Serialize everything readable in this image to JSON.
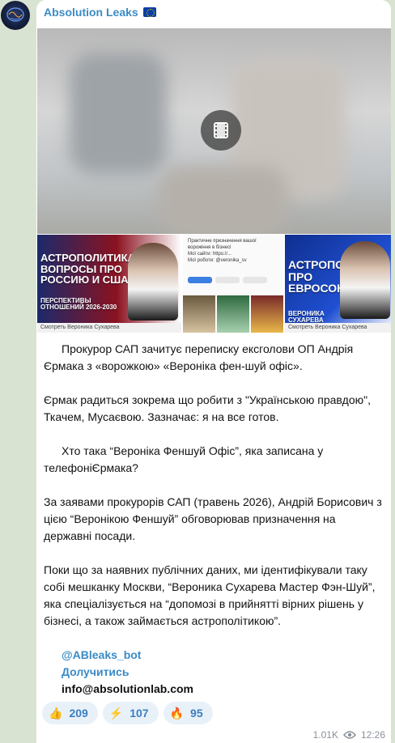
{
  "channel": {
    "name": "Absolution Leaks"
  },
  "thumbs": {
    "t1": {
      "title": "АСТРОПОЛИТИКА: ВОПРОСЫ ПРО РОССИЮ И США",
      "sub": "ПЕРСПЕКТИВЫ ОТНОШЕНИЙ 2026-2030",
      "caption": "Смотреть Вероника Сухарева"
    },
    "t2": {
      "lines": [
        "Практичне призначення вашої ворожіння в бізнесі",
        "Мої сайти: https://...",
        "Мої роботи: @veronika_sv"
      ],
      "caption": ""
    },
    "t3": {
      "title": "АСТРОПОЛИТИКА ПРО ЕВРОСОЮЗ",
      "sub": "ВЕРОНИКА СУХАРЕВА",
      "caption": "Смотреть Вероника Сухарева"
    }
  },
  "post": {
    "p1": "Прокурор САП зачитує переписку ексголови ОП Андрія Єрмака з «ворожкою» «Вероніка фен-шуй офіс».",
    "p2": "Єрмак радиться зокрема що робити з \"Українською правдою\", Ткачем, Мусаєвою. Зазначає: я на все готов.",
    "p3": "Хто така “Вероніка Феншуй Офіс”, яка записана у телефоніЄрмака?",
    "p4": "За заявами прокурорів САП (травень 2026), Андрій Борисович з цією “Веронікою Феншуй” обговорював призначення на державні посади.",
    "p5": "Поки що за наявних публічних даних, ми ідентифікували таку собі мешканку Москви, “Вероника Сухарева Мастер Фэн-Шуй”, яка спеціалізується на “допомозі в прийнятті вірних рішень у бізнесі, а також займається астрополітикою”."
  },
  "links": {
    "bot": "@ABleaks_bot",
    "join": "Долучитись",
    "email": "info@absolutionlab.com"
  },
  "reactions": [
    {
      "emoji": "👍",
      "count": "209"
    },
    {
      "emoji": "⚡",
      "count": "107"
    },
    {
      "emoji": "🔥",
      "count": "95"
    }
  ],
  "meta": {
    "views": "1.01K",
    "time": "12:26"
  },
  "colors": {
    "accent": "#3a8bc6",
    "bg": "#d9e3d2"
  }
}
